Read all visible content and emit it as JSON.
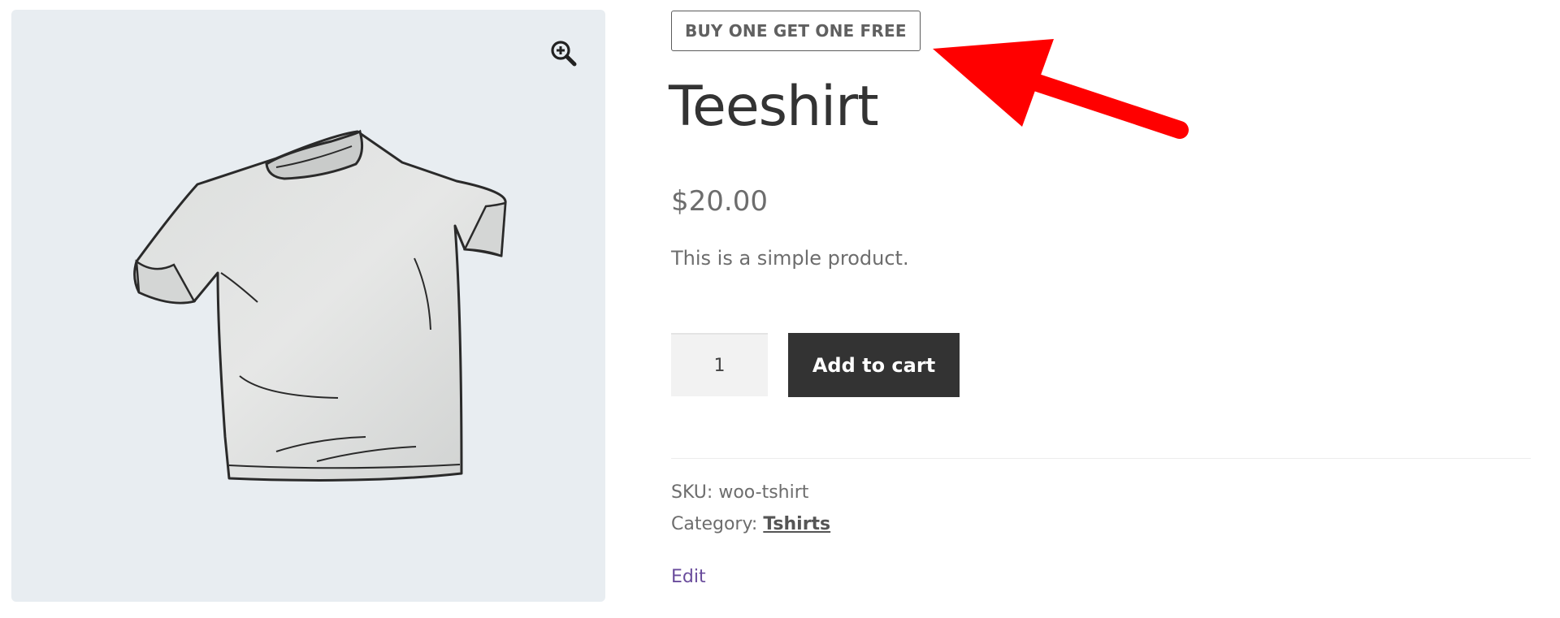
{
  "product": {
    "badge": "BUY ONE GET ONE FREE",
    "title": "Teeshirt",
    "price": "$20.00",
    "description": "This is a simple product.",
    "quantity": "1",
    "add_to_cart_label": "Add to cart",
    "sku_label": "SKU:",
    "sku_value": "woo-tshirt",
    "category_label": "Category:",
    "category_value": "Tshirts",
    "edit_label": "Edit"
  },
  "gallery": {
    "zoom_icon": "zoom-in-icon",
    "image": "tshirt-illustration"
  },
  "annotation": {
    "arrow_color": "#ff0000"
  },
  "colors": {
    "button_bg": "#333333",
    "gallery_bg": "#e8edf1",
    "edit_link": "#6a4c9c"
  }
}
